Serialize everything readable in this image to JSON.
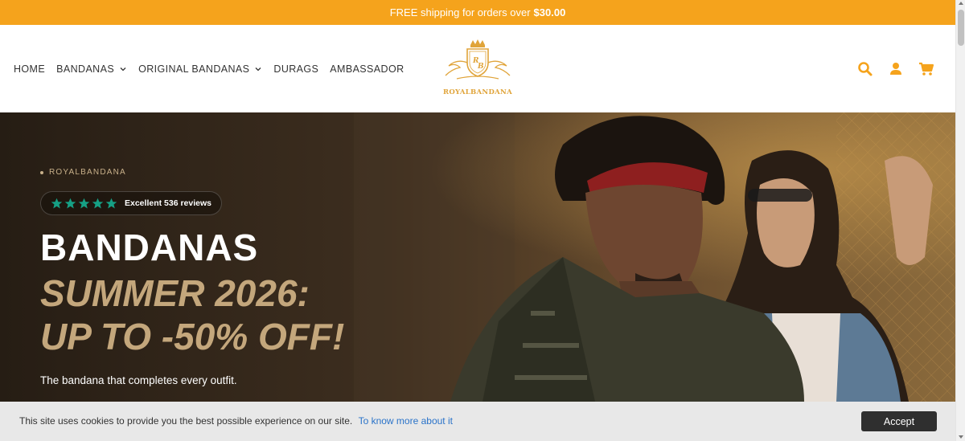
{
  "announcement": {
    "text": "FREE shipping for orders over",
    "amount": "$30.00"
  },
  "nav": {
    "items": [
      {
        "label": "HOME",
        "has_dropdown": false
      },
      {
        "label": "BANDANAS",
        "has_dropdown": true
      },
      {
        "label": "ORIGINAL BANDANAS",
        "has_dropdown": true
      },
      {
        "label": "DURAGS",
        "has_dropdown": false
      },
      {
        "label": "AMBASSADOR",
        "has_dropdown": false
      }
    ]
  },
  "logo": {
    "monogram": "RB",
    "text": "ROYALBANDANA"
  },
  "header_icons": [
    "search-icon",
    "user-icon",
    "cart-icon"
  ],
  "colors": {
    "accent": "#f5a31c",
    "hero_gold": "#c4a77c",
    "star_green": "#16a085",
    "link": "#2a73c9"
  },
  "hero": {
    "eyebrow": "ROYALBANDANA",
    "rating_stars": 5,
    "reviews_text": "Excellent 536 reviews",
    "title": "BANDANAS",
    "subtitle_line1": "SUMMER 2026:",
    "subtitle_line2": "UP TO -50% OFF!",
    "description": "The bandana that completes every outfit."
  },
  "cookie": {
    "text": "This site uses cookies to provide you the best possible experience on our site.",
    "link": "To know more about it",
    "accept": "Accept"
  }
}
